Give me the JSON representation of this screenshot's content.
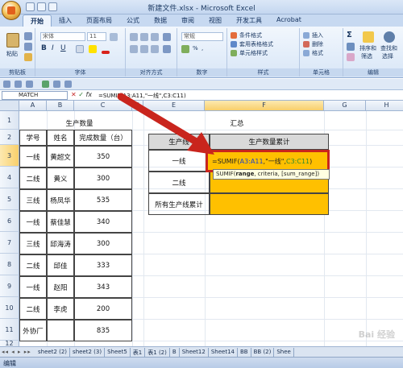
{
  "window": {
    "title": "新建文件.xlsx - Microsoft Excel"
  },
  "ribbon": {
    "tabs": [
      "开始",
      "插入",
      "页面布局",
      "公式",
      "数据",
      "审阅",
      "视图",
      "开发工具",
      "Acrobat"
    ],
    "clipboard": {
      "paste": "粘贴",
      "label": "剪贴板"
    },
    "font": {
      "name": "宋体",
      "size": "11",
      "label": "字体"
    },
    "alignment": {
      "label": "对齐方式"
    },
    "number": {
      "format": "常规",
      "label": "数字"
    },
    "styles": {
      "cond": "条件格式",
      "table": "套用表格格式",
      "cell": "单元格样式",
      "label": "样式"
    },
    "cells": {
      "insert": "插入",
      "delete": "删除",
      "format": "格式",
      "label": "单元格"
    },
    "editing": {
      "sort": "排序和",
      "sort2": "筛选",
      "find": "查找和",
      "find2": "选择",
      "label": "编辑"
    }
  },
  "formula_bar": {
    "name_box": "MATCH",
    "fx": "fx",
    "formula": "=SUMIF(A3:A11,\"一线\",C3:C11)"
  },
  "columns": [
    "A",
    "B",
    "C",
    "D",
    "E",
    "F",
    "G",
    "H"
  ],
  "rows": [
    "1",
    "2",
    "3",
    "4",
    "5",
    "6",
    "7",
    "8",
    "9",
    "10",
    "11",
    "12"
  ],
  "left_table": {
    "title": "生产数量",
    "headers": [
      "学号",
      "姓名",
      "完成数量（台）"
    ],
    "rows": [
      [
        "一线",
        "黄超文",
        "350"
      ],
      [
        "二线",
        "黄义",
        "300"
      ],
      [
        "三线",
        "杨凤华",
        "535"
      ],
      [
        "一线",
        "蔡佳慧",
        "340"
      ],
      [
        "三线",
        "邱海涛",
        "300"
      ],
      [
        "二线",
        "邱佳",
        "333"
      ],
      [
        "一线",
        "赵阳",
        "343"
      ],
      [
        "二线",
        "李虎",
        "200"
      ],
      [
        "外协厂",
        "",
        "835"
      ]
    ]
  },
  "right_table": {
    "title": "汇总",
    "headers": [
      "生产线",
      "生产数量累计"
    ],
    "rows": [
      "一线",
      "二线",
      "所有生产线累计"
    ]
  },
  "editing_cell": {
    "part1": "=SUMIF(",
    "part2": "A3:A11",
    "part3": ",\"一线\",",
    "part4": "C3:C11",
    "part5": ")",
    "tooltip_fn": "SUMIF(",
    "tooltip_arg": "range",
    "tooltip_rest": ", criteria, [sum_range])"
  },
  "sheets": [
    "sheet2 (2)",
    "sheet2 (3)",
    "Sheet5",
    "表1",
    "表1 (2)",
    "B",
    "Sheet12",
    "Sheet14",
    "BB",
    "BB (2)",
    "Shee"
  ],
  "status": "编辑",
  "colors": {
    "accent_red": "#c9251d",
    "orange_fill": "#ffc000",
    "header_gray": "#d9d9d9"
  }
}
